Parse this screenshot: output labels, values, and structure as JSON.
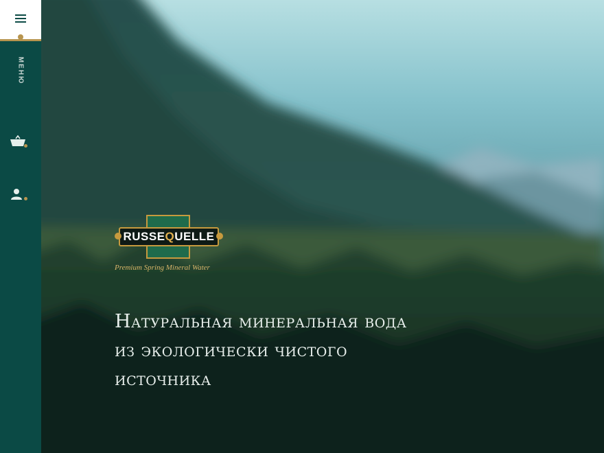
{
  "sidebar": {
    "menu_label": "Меню",
    "accent_color": "#b8954f",
    "background_color": "#0b4a45",
    "icons": [
      "menu-icon",
      "cart-icon",
      "user-icon"
    ]
  },
  "hero": {
    "logo": {
      "brand_first": "RUSSE",
      "brand_q": "Q",
      "brand_last": "UELLE",
      "tagline": "Premium Spring Mineral Water"
    },
    "heading_line1": "Натуральная минеральная вода",
    "heading_line2": "из экологически чистого",
    "heading_line3": "источника"
  }
}
